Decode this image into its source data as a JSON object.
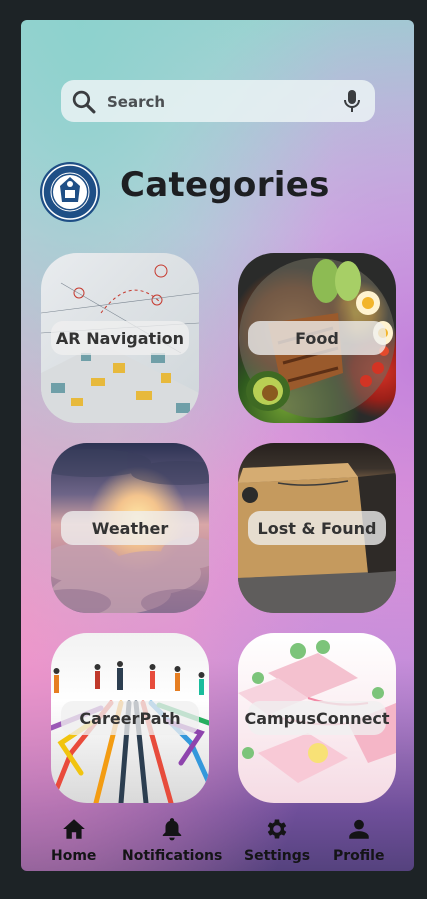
{
  "search": {
    "placeholder": "Search"
  },
  "header": {
    "title": "Categories"
  },
  "categories": [
    {
      "label": "AR Navigation"
    },
    {
      "label": "Food"
    },
    {
      "label": "Weather"
    },
    {
      "label": "Lost & Found"
    },
    {
      "label": "CareerPath"
    },
    {
      "label": "CampusConnect"
    }
  ],
  "nav": {
    "items": [
      {
        "label": "Home",
        "icon": "home-icon"
      },
      {
        "label": "Notifications",
        "icon": "bell-icon"
      },
      {
        "label": "Settings",
        "icon": "gear-icon"
      },
      {
        "label": "Profile",
        "icon": "person-icon"
      }
    ]
  },
  "colors": {
    "text_dark": "#1d1f22",
    "logo_blue": "#1f4f86",
    "app_border": "#1d2326"
  }
}
